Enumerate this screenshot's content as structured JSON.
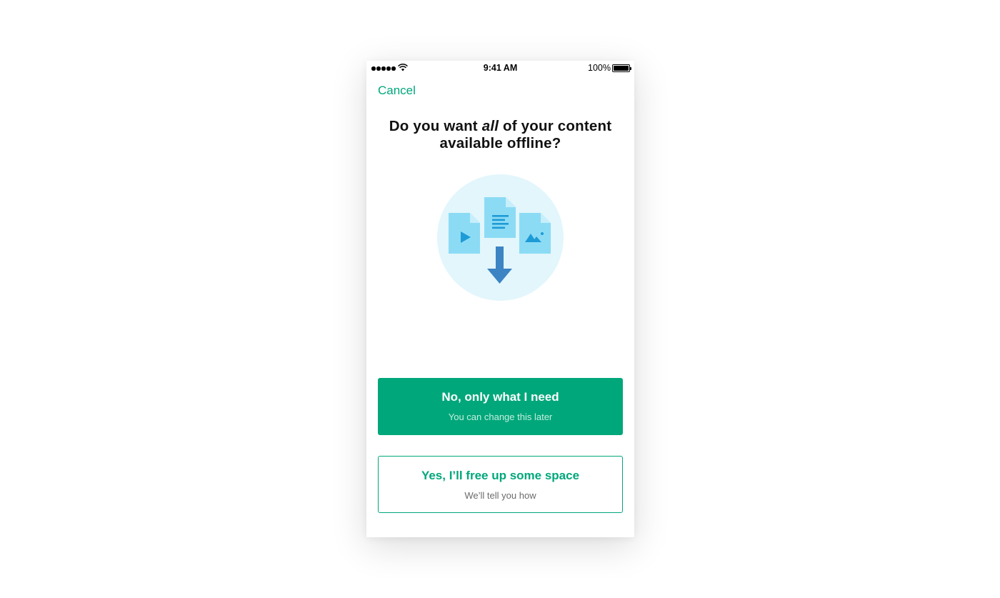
{
  "status_bar": {
    "time": "9:41 AM",
    "battery": "100%"
  },
  "nav": {
    "cancel_label": "Cancel"
  },
  "prompt": {
    "before": "Do you want ",
    "emphasis": "all",
    "after": " of your content available offline?"
  },
  "illustration": {
    "icon": "offline-download-illustration",
    "items": [
      "video-file-icon",
      "document-file-icon",
      "image-file-icon",
      "download-arrow-icon"
    ],
    "colors": {
      "circle": "#e2f6fc",
      "file": "#8cdbf5",
      "glyph": "#1d9bd6",
      "arrow": "#3c84c3"
    }
  },
  "options": [
    {
      "title": "No, only what I need",
      "subtitle": "You can change this later",
      "style": "primary"
    },
    {
      "title": "Yes, I’ll free up some space",
      "subtitle": "We’ll tell you how",
      "style": "secondary"
    }
  ],
  "colors": {
    "accent": "#00a77b"
  }
}
